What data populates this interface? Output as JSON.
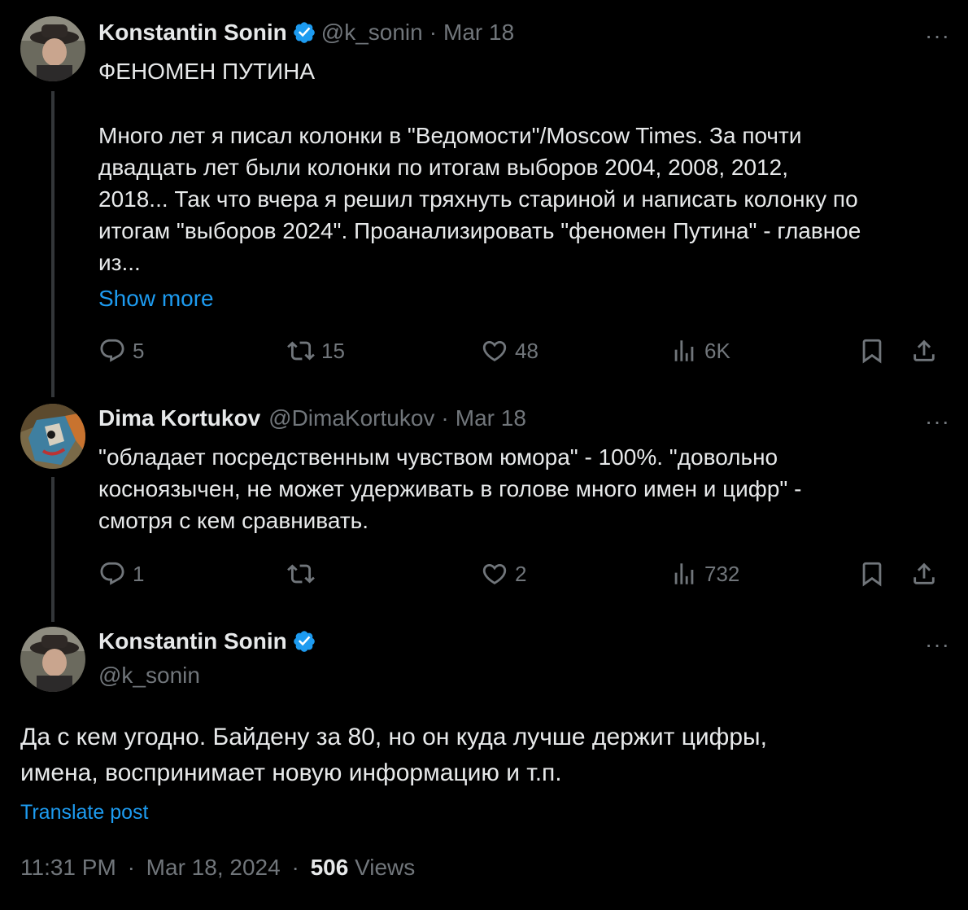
{
  "tweet1": {
    "author_name": "Konstantin Sonin",
    "handle": "@k_sonin",
    "date": "Mar 18",
    "title_line": "ФЕНОМЕН ПУТИНА",
    "body_lines": [
      "Много лет я писал колонки в \"Ведомости\"/Moscow Times. За почти",
      "двадцать лет были колонки по итогам выборов 2004, 2008, 2012,",
      "2018... Так что вчера я решил тряхнуть стариной и написать колонку по",
      "итогам \"выборов 2024\". Проанализировать \"феномен Путина\" - главное",
      "из..."
    ],
    "show_more": "Show more",
    "replies": "5",
    "reposts": "15",
    "likes": "48",
    "views": "6K"
  },
  "tweet2": {
    "author_name": "Dima Kortukov",
    "handle": "@DimaKortukov",
    "date": "Mar 18",
    "body_lines": [
      "\"обладает посредственным чувством юмора\" - 100%. \"довольно",
      "косноязычен, не может удерживать в голове много имен и цифр\" -",
      "смотря с кем сравнивать."
    ],
    "replies": "1",
    "reposts": "",
    "likes": "2",
    "views": "732"
  },
  "tweet3": {
    "author_name": "Konstantin Sonin",
    "handle": "@k_sonin",
    "body_lines": [
      "Да с кем угодно. Байдену за 80, но он куда лучше держит цифры,",
      "имена, воспринимает новую информацию и т.п."
    ],
    "translate": "Translate post",
    "time": "11:31 PM",
    "full_date": "Mar 18, 2024",
    "views_count": "506",
    "views_label": "Views"
  },
  "separator": "·",
  "more_glyph": "···",
  "colors": {
    "background": "#000000",
    "text": "#e7e9ea",
    "secondary": "#71767b",
    "accent": "#1d9bf0",
    "thread": "#333639"
  },
  "icons": [
    "verified-badge-icon",
    "reply-icon",
    "repost-icon",
    "like-icon",
    "views-icon",
    "bookmark-icon",
    "share-icon",
    "more-icon"
  ]
}
